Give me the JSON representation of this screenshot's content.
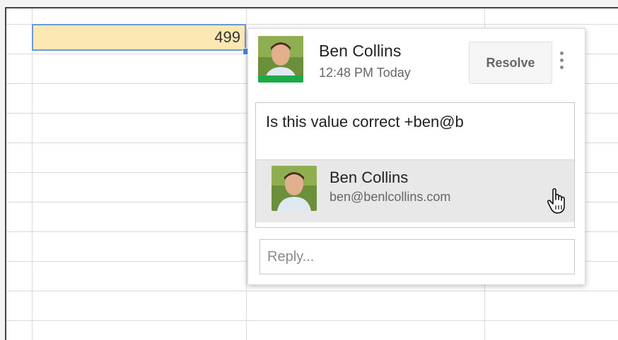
{
  "sheet": {
    "selected_cell_value": "499"
  },
  "comment": {
    "author_name": "Ben Collins",
    "timestamp": "12:48 PM Today",
    "resolve_label": "Resolve",
    "compose_text": "Is this value correct +ben@b",
    "suggestion": {
      "name": "Ben Collins",
      "email": "ben@benlcollins.com"
    },
    "reply_placeholder": "Reply..."
  },
  "colors": {
    "selected_cell_fill": "#fce8b2",
    "selection_border": "#6c9ad8",
    "avatar_status_bar": "#1eaa4a"
  },
  "icons": {
    "more": "vertical-dots-icon",
    "cursor": "hand-pointer-icon"
  }
}
